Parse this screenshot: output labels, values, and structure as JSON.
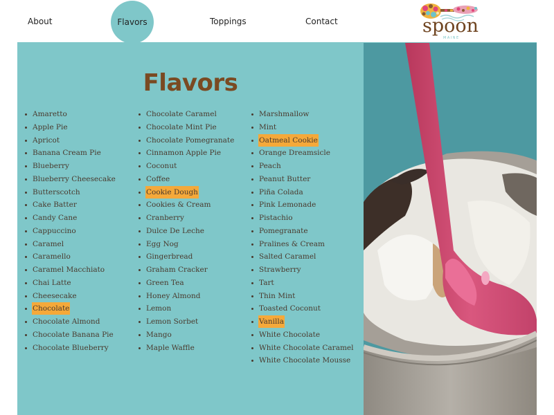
{
  "nav": {
    "items": [
      {
        "label": "About",
        "active": false
      },
      {
        "label": "Flavors",
        "active": true
      },
      {
        "label": "Toppings",
        "active": false
      },
      {
        "label": "Contact",
        "active": false
      }
    ]
  },
  "logo": {
    "word": "spoon",
    "sub": "MAINE"
  },
  "colors": {
    "accent_teal": "#7fc7c9",
    "title_brown": "#7a4a22",
    "highlight_orange": "#f5a93a",
    "spoon_pink": "#e05a84"
  },
  "main": {
    "title": "Flavors",
    "columns": [
      [
        {
          "name": "Amaretto",
          "highlighted": false
        },
        {
          "name": "Apple Pie",
          "highlighted": false
        },
        {
          "name": "Apricot",
          "highlighted": false
        },
        {
          "name": "Banana Cream Pie",
          "highlighted": false
        },
        {
          "name": "Blueberry",
          "highlighted": false
        },
        {
          "name": "Blueberry Cheesecake",
          "highlighted": false
        },
        {
          "name": "Butterscotch",
          "highlighted": false
        },
        {
          "name": "Cake Batter",
          "highlighted": false
        },
        {
          "name": "Candy Cane",
          "highlighted": false
        },
        {
          "name": "Cappuccino",
          "highlighted": false
        },
        {
          "name": "Caramel",
          "highlighted": false
        },
        {
          "name": "Caramello",
          "highlighted": false
        },
        {
          "name": "Caramel Macchiato",
          "highlighted": false
        },
        {
          "name": "Chai Latte",
          "highlighted": false
        },
        {
          "name": "Cheesecake",
          "highlighted": false
        },
        {
          "name": "Chocolate",
          "highlighted": true
        },
        {
          "name": "Chocolate Almond",
          "highlighted": false
        },
        {
          "name": "Chocolate Banana Pie",
          "highlighted": false
        },
        {
          "name": "Chocolate Blueberry",
          "highlighted": false
        }
      ],
      [
        {
          "name": "Chocolate Caramel",
          "highlighted": false
        },
        {
          "name": "Chocolate Mint Pie",
          "highlighted": false
        },
        {
          "name": "Chocolate Pomegranate",
          "highlighted": false
        },
        {
          "name": "Cinnamon Apple Pie",
          "highlighted": false
        },
        {
          "name": "Coconut",
          "highlighted": false
        },
        {
          "name": "Coffee",
          "highlighted": false
        },
        {
          "name": "Cookie Dough",
          "highlighted": true
        },
        {
          "name": "Cookies & Cream",
          "highlighted": false
        },
        {
          "name": "Cranberry",
          "highlighted": false
        },
        {
          "name": "Dulce De Leche",
          "highlighted": false
        },
        {
          "name": "Egg Nog",
          "highlighted": false
        },
        {
          "name": "Gingerbread",
          "highlighted": false
        },
        {
          "name": "Graham Cracker",
          "highlighted": false
        },
        {
          "name": "Green Tea",
          "highlighted": false
        },
        {
          "name": "Honey Almond",
          "highlighted": false
        },
        {
          "name": "Lemon",
          "highlighted": false
        },
        {
          "name": "Lemon Sorbet",
          "highlighted": false
        },
        {
          "name": "Mango",
          "highlighted": false
        },
        {
          "name": "Maple Waffle",
          "highlighted": false
        }
      ],
      [
        {
          "name": "Marshmallow",
          "highlighted": false
        },
        {
          "name": "Mint",
          "highlighted": false
        },
        {
          "name": "Oatmeal Cookie",
          "highlighted": true
        },
        {
          "name": "Orange Dreamsicle",
          "highlighted": false
        },
        {
          "name": "Peach",
          "highlighted": false
        },
        {
          "name": "Peanut Butter",
          "highlighted": false
        },
        {
          "name": "Piña Colada",
          "highlighted": false
        },
        {
          "name": "Pink Lemonade",
          "highlighted": false
        },
        {
          "name": "Pistachio",
          "highlighted": false
        },
        {
          "name": "Pomegranate",
          "highlighted": false
        },
        {
          "name": "Pralines & Cream",
          "highlighted": false
        },
        {
          "name": "Salted Caramel",
          "highlighted": false
        },
        {
          "name": "Strawberry",
          "highlighted": false
        },
        {
          "name": "Tart",
          "highlighted": false
        },
        {
          "name": "Thin Mint",
          "highlighted": false
        },
        {
          "name": "Toasted Coconut",
          "highlighted": false
        },
        {
          "name": "Vanilla",
          "highlighted": true
        },
        {
          "name": "White Chocolate",
          "highlighted": false
        },
        {
          "name": "White Chocolate Caramel",
          "highlighted": false
        },
        {
          "name": "White Chocolate Mousse",
          "highlighted": false
        }
      ]
    ]
  },
  "photo": {
    "subject": "ice-cream-cup-with-pink-spoon"
  }
}
